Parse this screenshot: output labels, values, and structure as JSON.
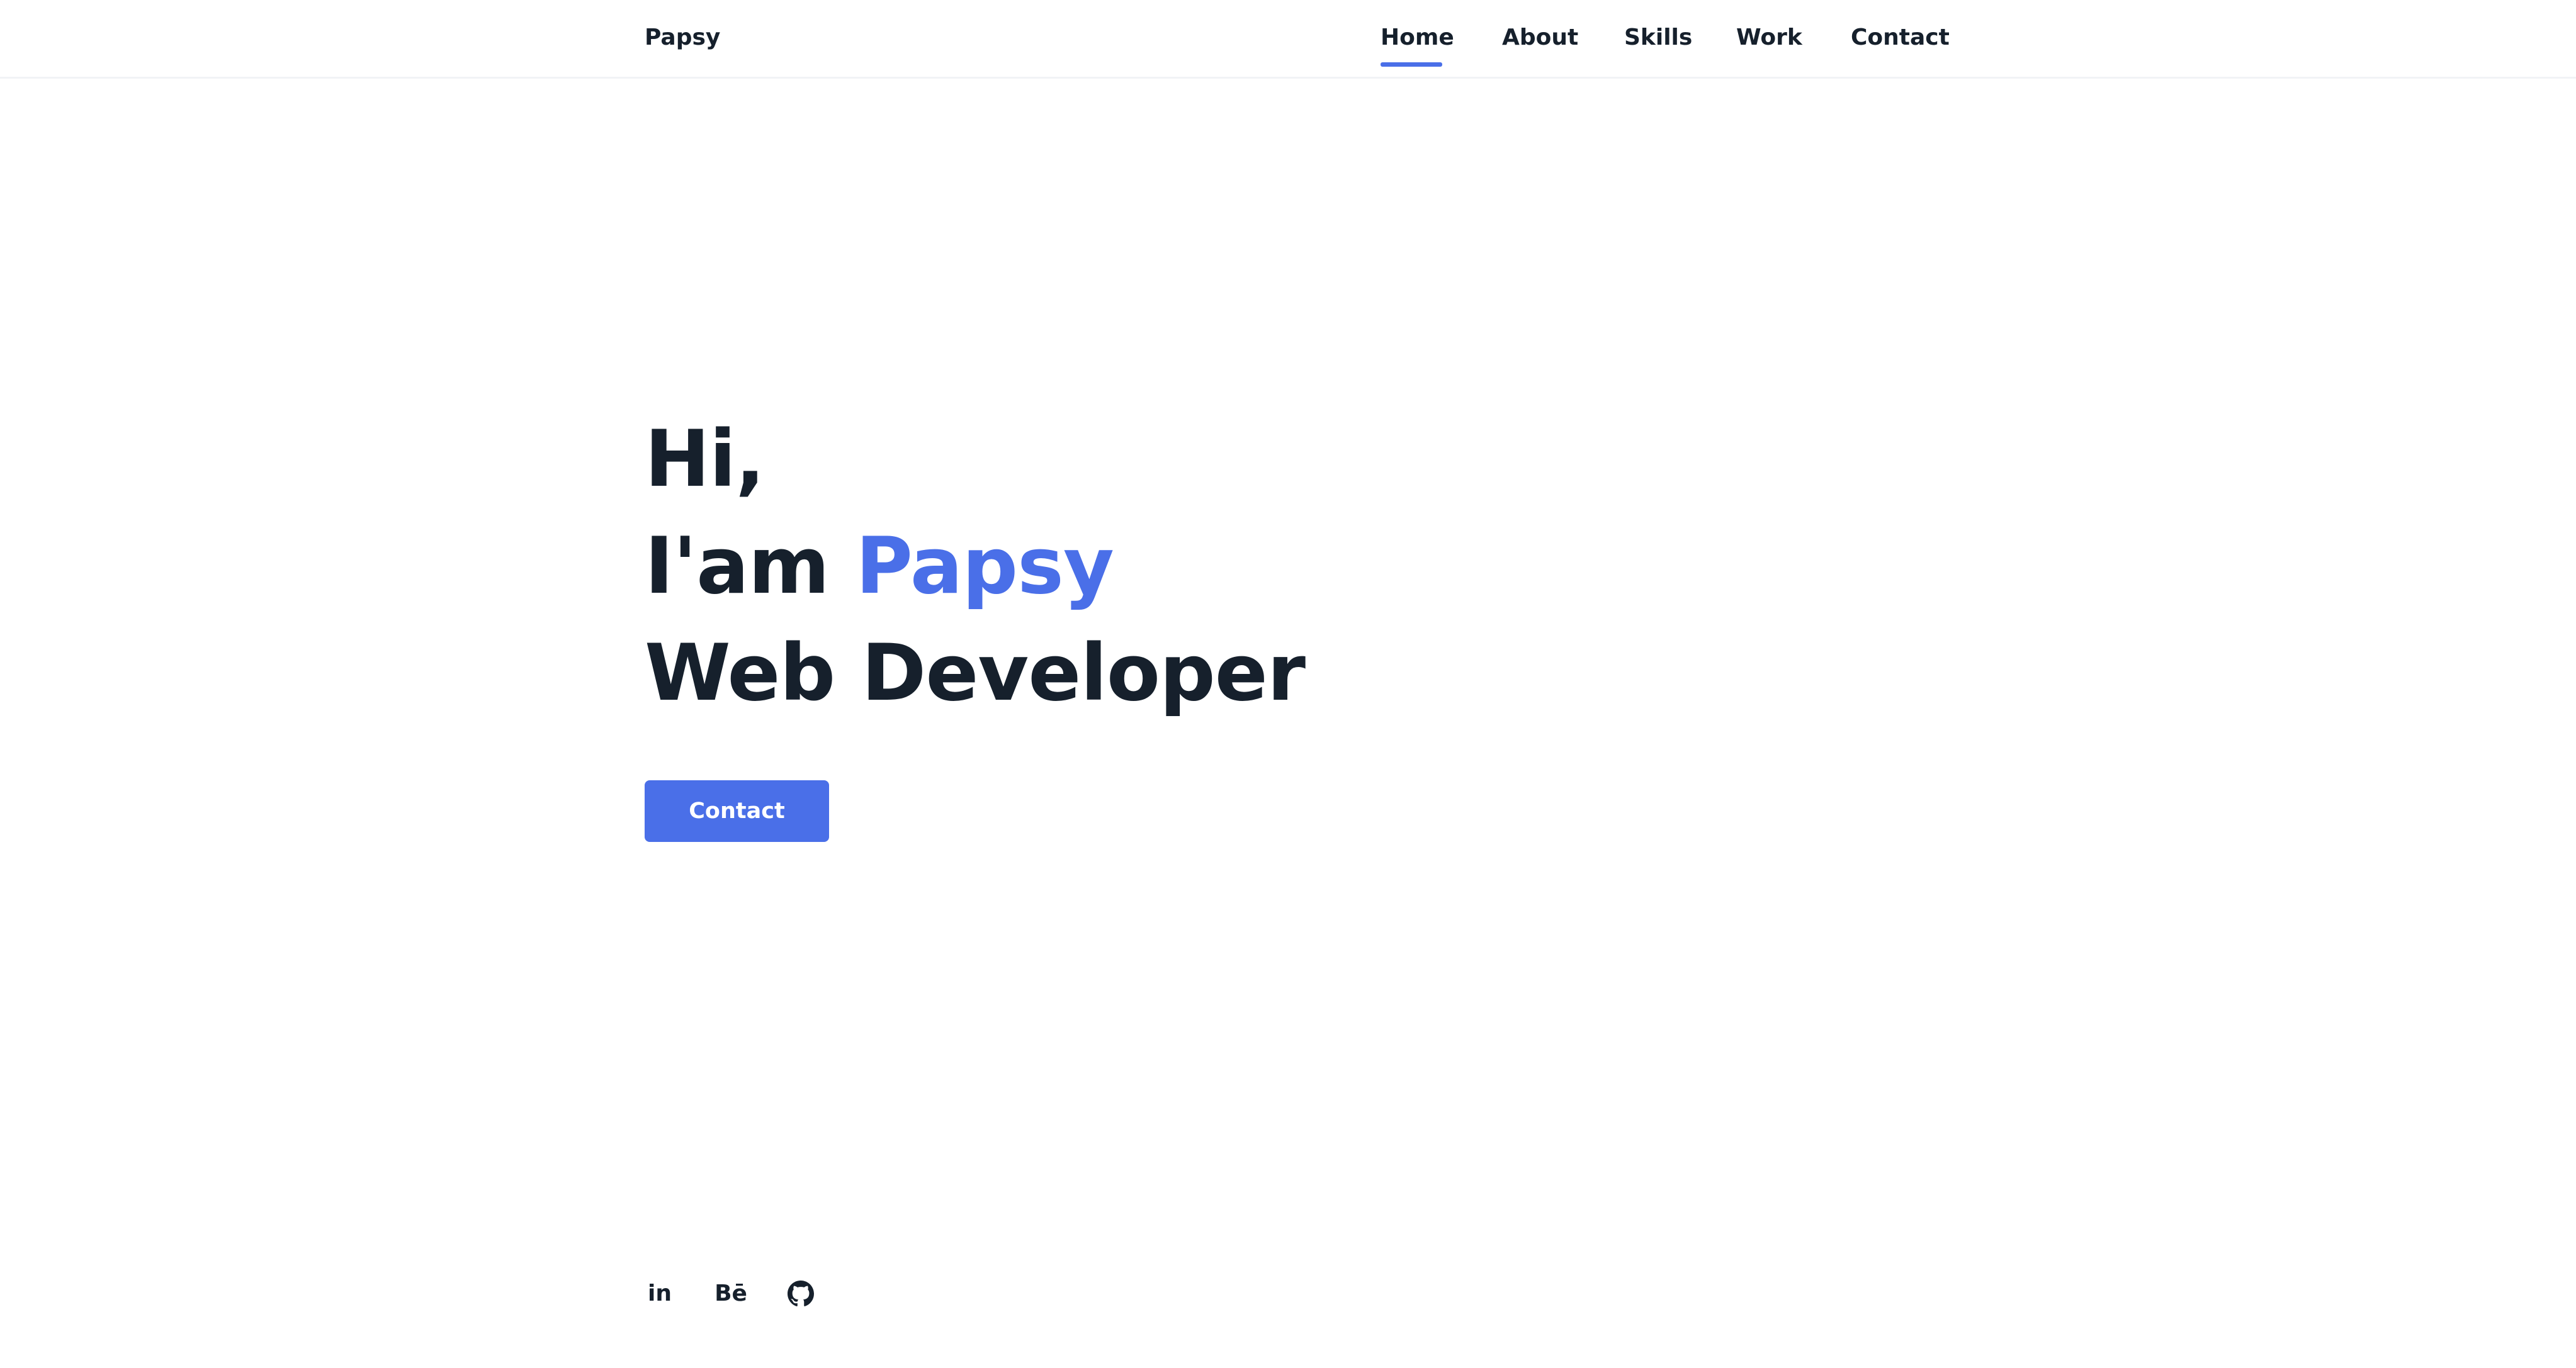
{
  "header": {
    "logo": "Papsy",
    "nav": [
      {
        "label": "Home",
        "active": true
      },
      {
        "label": "About",
        "active": false
      },
      {
        "label": "Skills",
        "active": false
      },
      {
        "label": "Work",
        "active": false
      },
      {
        "label": "Contact",
        "active": false
      }
    ]
  },
  "hero": {
    "greeting": "Hi,",
    "intro_prefix": "I'am",
    "name": "Papsy",
    "role": "Web Developer",
    "cta_label": "Contact"
  },
  "social": [
    {
      "icon": "linkedin-icon",
      "label": "in"
    },
    {
      "icon": "behance-icon",
      "label": "Bē"
    },
    {
      "icon": "github-icon",
      "label": ""
    }
  ],
  "colors": {
    "accent": "#4a6fe8",
    "text": "#16202c",
    "background": "#ffffff"
  }
}
